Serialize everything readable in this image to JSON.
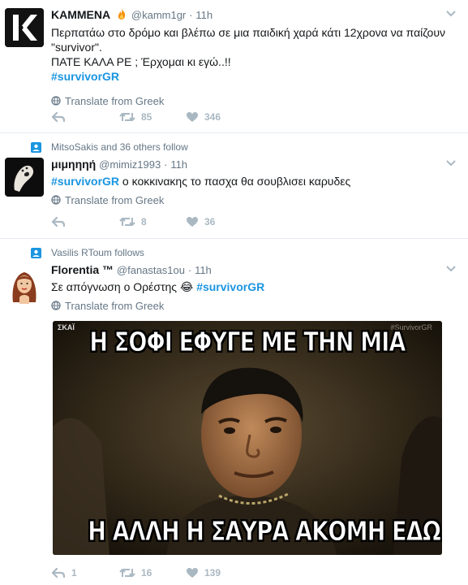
{
  "colors": {
    "link": "#1b95e0",
    "muted": "#657786",
    "icon": "#aab8c2",
    "divider": "#e6ecf0"
  },
  "tweets": [
    {
      "fullname": "ΚΑΜΜΕΝΑ",
      "name_emoji": "fire",
      "handle": "@kamm1gr",
      "dot": "·",
      "time": "11h",
      "text_line1": "Περπατάω στο δρόμο και βλέπω σε μια παιδική χαρά κάτι 12χρονα να παίζουν \"survivor\".",
      "text_line2": "ΠΑΤΕ ΚΑΛΑ ΡΕ ; Έρχομαι κι εγώ..!!",
      "hashtag": "#survivorGR",
      "translate": "Translate from Greek",
      "reply_count": "",
      "retweet_count": "85",
      "like_count": "346",
      "avatar_letter": "K"
    },
    {
      "context": "MitsoSakis and 36 others follow",
      "fullname": "μιμηηηή",
      "handle": "@mimiz1993",
      "dot": "·",
      "time": "11h",
      "hashtag": "#survivorGR",
      "text_after": " ο κοκκινακης το πασχα θα σουβλισει καρυδες",
      "translate": "Translate from Greek",
      "reply_count": "",
      "retweet_count": "8",
      "like_count": "36"
    },
    {
      "context": "Vasilis RToum follows",
      "fullname": "Florentia ™",
      "handle": "@fanastas1ou",
      "dot": "·",
      "time": "11h",
      "text_before": "Σε απόγνωση ο Ορέστης ",
      "text_emoji": "😂",
      "hashtag": "#survivorGR",
      "translate": "Translate from Greek",
      "meme_top": "Η ΣΟΦΙ ΕΦΥΓΕ ΜΕ ΤΗΝ ΜΙΑ",
      "meme_bottom": "Η ΑΛΛΗ Η ΣΑΥΡΑ ΑΚΟΜΗ ΕΔΩ",
      "meme_channel": "ΣΚΑΪ",
      "meme_watermark": "#SurvivorGR",
      "reply_count": "1",
      "retweet_count": "16",
      "like_count": "139"
    }
  ]
}
